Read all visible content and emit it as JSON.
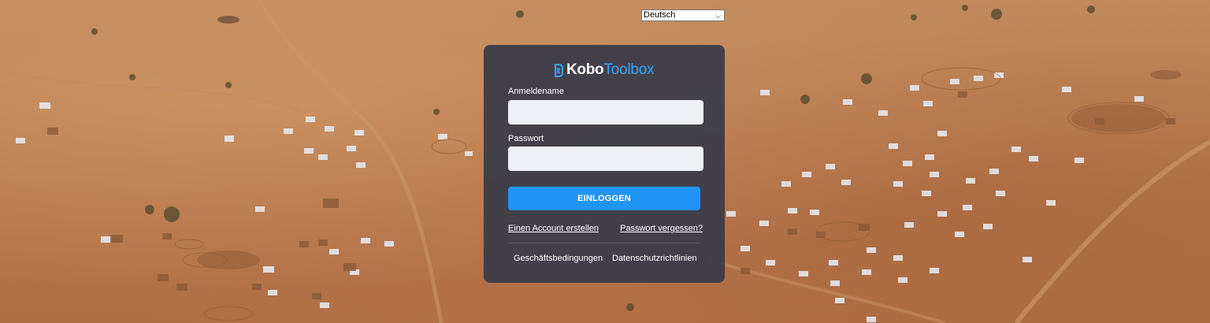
{
  "language_select": {
    "selected": "Deutsch"
  },
  "logo": {
    "part1": "Kobo",
    "part2": "Toolbox"
  },
  "form": {
    "username_label": "Anmeldename",
    "username_value": "",
    "password_label": "Passwort",
    "password_value": "",
    "login_button": "EINLOGGEN"
  },
  "links": {
    "create_account": "Einen Account erstellen",
    "forgot_password": "Passwort vergessen?"
  },
  "footer": {
    "terms": "Geschäftsbedingungen",
    "privacy": "Datenschutzrichtlinien"
  },
  "colors": {
    "accent": "#2095f3",
    "logo_accent": "#34a5ff",
    "card": "#3a3c48",
    "input_bg": "#eff0f5"
  }
}
